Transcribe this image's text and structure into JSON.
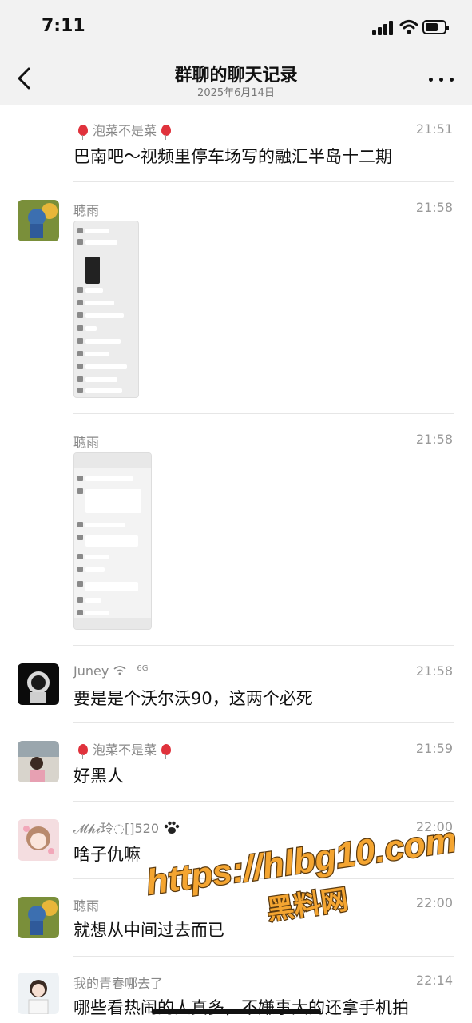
{
  "status_bar": {
    "time": "7:11"
  },
  "header": {
    "title": "群聊的聊天记录",
    "subtitle": "2025年6月14日"
  },
  "messages": [
    {
      "sender": "泡菜不是菜",
      "time": "21:51",
      "text": "巴南吧～视频里停车场写的融汇半岛十二期"
    },
    {
      "sender": "聴雨",
      "time": "21:58",
      "image": "screenshot-thumbnail"
    },
    {
      "sender": "聴雨",
      "time": "21:58",
      "image": "screenshot-thumbnail"
    },
    {
      "sender": "Juney",
      "sender_suffix": "6G",
      "time": "21:58",
      "text": "要是是个沃尔沃90，这两个必死"
    },
    {
      "sender": "泡菜不是菜",
      "time": "21:59",
      "text": "好黑人"
    },
    {
      "sender": "𝓜𝓱𝓲玲◌[]520",
      "time": "22:00",
      "text": "啥子仇嘛"
    },
    {
      "sender": "聴雨",
      "time": "22:00",
      "text": "就想从中间过去而已"
    },
    {
      "sender": "我的青春哪去了",
      "time": "22:14",
      "text": "哪些看热闹的人真多，不嫌事大的还拿手机拍"
    }
  ],
  "watermark": {
    "url": "https://hlbg10.com",
    "label": "黑料网"
  },
  "colors": {
    "background": "#ffffff",
    "header_bg": "#f2f2f2",
    "balloon": "#e0323c",
    "watermark_fill": "#f4a531"
  }
}
